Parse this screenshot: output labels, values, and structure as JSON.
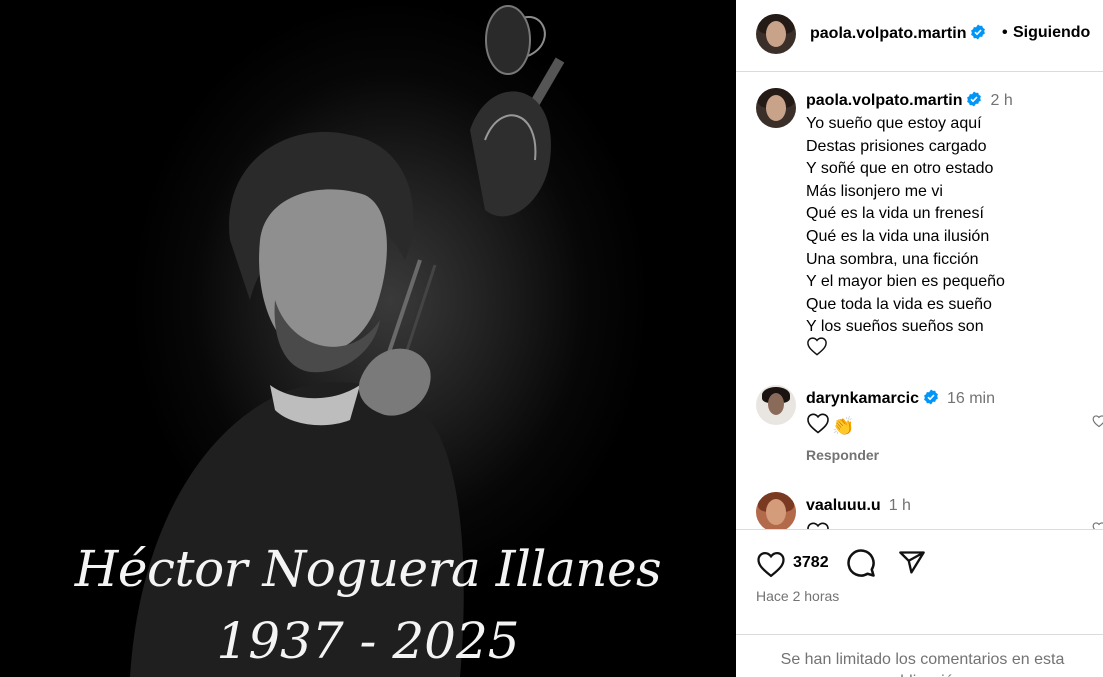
{
  "media": {
    "name_text": "Héctor Noguera Illanes",
    "years_text": "1937 - 2025"
  },
  "header": {
    "username": "paola.volpato.martin",
    "separator": "•",
    "follow_label": "Siguiendo"
  },
  "caption": {
    "username": "paola.volpato.martin",
    "time": "2 h",
    "lines": [
      "Yo sueño que estoy aquí",
      "Destas prisiones cargado",
      "Y soñé que en otro estado",
      "Más lisonjero me vi",
      "Qué es la vida un frenesí",
      "Qué es la vida una ilusión",
      "Una sombra, una ficción",
      "Y el mayor bien es pequeño",
      "Que toda la vida es sueño",
      "Y los sueños sueños son"
    ],
    "trailing_emoji": "heart-outline"
  },
  "comments": [
    {
      "username": "darynkamarcic",
      "verified": true,
      "time": "16 min",
      "emojis": [
        "heart-outline",
        "clapping-hands"
      ],
      "reply_label": "Responder"
    },
    {
      "username": "vaaluuu.u",
      "verified": false,
      "time": "1 h"
    }
  ],
  "actions": {
    "likes_count": "3782",
    "posted_ago": "Hace 2 horas"
  },
  "footer": {
    "limited_text": "Se han limitado los comentarios en esta publicación"
  },
  "colors": {
    "verified_blue": "#0095f6",
    "secondary_text": "#737373",
    "divider": "#dbdbdb"
  }
}
